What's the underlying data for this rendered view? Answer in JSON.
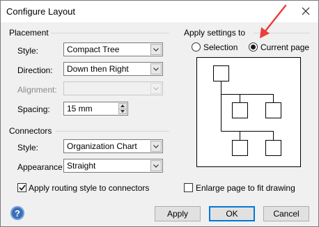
{
  "window": {
    "title": "Configure Layout"
  },
  "placement": {
    "heading": "Placement",
    "style": {
      "label": "Style:",
      "value": "Compact Tree"
    },
    "direction": {
      "label": "Direction:",
      "value": "Down then Right"
    },
    "alignment": {
      "label": "Alignment:",
      "value": ""
    },
    "spacing": {
      "label": "Spacing:",
      "value": "15 mm"
    }
  },
  "connectors": {
    "heading": "Connectors",
    "style": {
      "label": "Style:",
      "value": "Organization Chart"
    },
    "appearance": {
      "label": "Appearance:",
      "value": "Straight"
    },
    "apply_routing": {
      "label": "Apply routing style to connectors",
      "checked": true
    }
  },
  "apply_settings": {
    "heading": "Apply settings to",
    "options": [
      {
        "label": "Selection",
        "selected": false
      },
      {
        "label": "Current page",
        "selected": true
      }
    ]
  },
  "enlarge_page": {
    "label": "Enlarge page to fit drawing",
    "checked": false
  },
  "buttons": {
    "apply": "Apply",
    "ok": "OK",
    "cancel": "Cancel",
    "help": "?"
  },
  "colors": {
    "accent_border": "#0078d7",
    "annotation_arrow": "#e8413b"
  }
}
